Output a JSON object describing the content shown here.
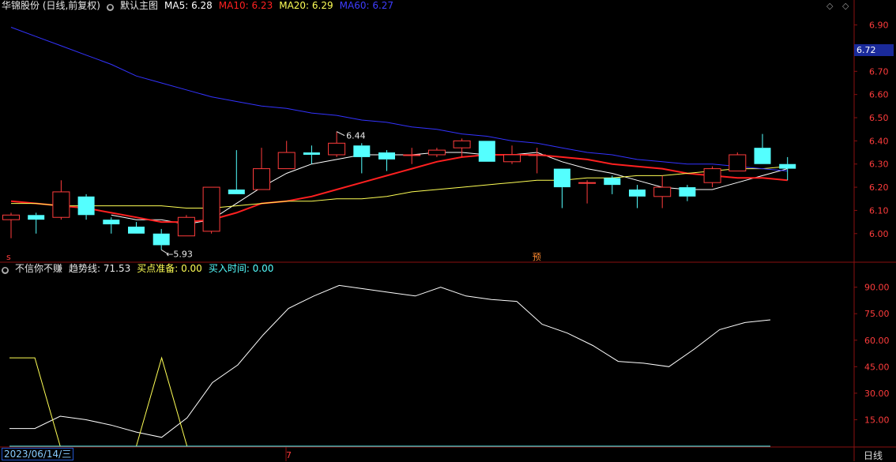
{
  "header": {
    "stock": "华锦股份 (日线,前复权)",
    "main_chart_label": "默认主图",
    "ma5": "MA5: 6.28",
    "ma10": "MA10: 6.23",
    "ma20": "MA20: 6.29",
    "ma60": "MA60: 6.27",
    "colors": {
      "ma5": "#ffffff",
      "ma10": "#ff2020",
      "ma20": "#ffff55",
      "ma60": "#3333ff"
    }
  },
  "indicator_header": {
    "name": "不信你不赚",
    "trend": "趋势线: 71.53",
    "buy_prep": "买点准备: 0.00",
    "buy_time": "买入时间: 0.00"
  },
  "current_price_tag": "6.72",
  "bottom": {
    "date": "2023/06/14/三",
    "period": "日线",
    "month_marker": "7"
  },
  "chart_data": [
    {
      "type": "candlestick",
      "ylim": [
        5.88,
        6.96
      ],
      "yticks": [
        "6.90",
        "6.80",
        "6.70",
        "6.60",
        "6.50",
        "6.40",
        "6.30",
        "6.20",
        "6.10",
        "6.00"
      ],
      "annotations": [
        {
          "text": "6.44",
          "label": "high",
          "candle_index": 13
        },
        {
          "text": "5.93",
          "label": "low",
          "candle_index": 6
        }
      ],
      "marker_labels": [
        {
          "text": "s",
          "candle_index": 0
        },
        {
          "text": "预",
          "candle_index": 21
        }
      ],
      "candles": [
        {
          "o": 6.06,
          "h": 6.09,
          "l": 5.98,
          "c": 6.08
        },
        {
          "o": 6.08,
          "h": 6.09,
          "l": 6.0,
          "c": 6.06
        },
        {
          "o": 6.07,
          "h": 6.23,
          "l": 6.06,
          "c": 6.18
        },
        {
          "o": 6.16,
          "h": 6.17,
          "l": 6.06,
          "c": 6.08
        },
        {
          "o": 6.06,
          "h": 6.07,
          "l": 6.0,
          "c": 6.04
        },
        {
          "o": 6.03,
          "h": 6.05,
          "l": 6.0,
          "c": 6.0
        },
        {
          "o": 6.0,
          "h": 6.02,
          "l": 5.93,
          "c": 5.95
        },
        {
          "o": 5.99,
          "h": 6.08,
          "l": 5.99,
          "c": 6.07
        },
        {
          "o": 6.01,
          "h": 6.2,
          "l": 6.0,
          "c": 6.2
        },
        {
          "o": 6.19,
          "h": 6.36,
          "l": 6.17,
          "c": 6.17
        },
        {
          "o": 6.19,
          "h": 6.37,
          "l": 6.19,
          "c": 6.28
        },
        {
          "o": 6.28,
          "h": 6.4,
          "l": 6.28,
          "c": 6.35
        },
        {
          "o": 6.35,
          "h": 6.38,
          "l": 6.3,
          "c": 6.34
        },
        {
          "o": 6.34,
          "h": 6.44,
          "l": 6.33,
          "c": 6.39
        },
        {
          "o": 6.38,
          "h": 6.39,
          "l": 6.26,
          "c": 6.33
        },
        {
          "o": 6.35,
          "h": 6.36,
          "l": 6.27,
          "c": 6.32
        },
        {
          "o": 6.34,
          "h": 6.37,
          "l": 6.3,
          "c": 6.34
        },
        {
          "o": 6.34,
          "h": 6.37,
          "l": 6.33,
          "c": 6.36
        },
        {
          "o": 6.37,
          "h": 6.41,
          "l": 6.33,
          "c": 6.4
        },
        {
          "o": 6.4,
          "h": 6.4,
          "l": 6.31,
          "c": 6.31
        },
        {
          "o": 6.31,
          "h": 6.38,
          "l": 6.3,
          "c": 6.34
        },
        {
          "o": 6.34,
          "h": 6.37,
          "l": 6.26,
          "c": 6.34
        },
        {
          "o": 6.28,
          "h": 6.28,
          "l": 6.11,
          "c": 6.2
        },
        {
          "o": 6.22,
          "h": 6.23,
          "l": 6.13,
          "c": 6.22
        },
        {
          "o": 6.24,
          "h": 6.25,
          "l": 6.17,
          "c": 6.21
        },
        {
          "o": 6.19,
          "h": 6.21,
          "l": 6.11,
          "c": 6.16
        },
        {
          "o": 6.16,
          "h": 6.25,
          "l": 6.11,
          "c": 6.2
        },
        {
          "o": 6.2,
          "h": 6.21,
          "l": 6.14,
          "c": 6.16
        },
        {
          "o": 6.22,
          "h": 6.29,
          "l": 6.2,
          "c": 6.28
        },
        {
          "o": 6.27,
          "h": 6.35,
          "l": 6.27,
          "c": 6.34
        },
        {
          "o": 6.37,
          "h": 6.43,
          "l": 6.3,
          "c": 6.3
        },
        {
          "o": 6.3,
          "h": 6.33,
          "l": 6.23,
          "c": 6.28
        }
      ],
      "series": [
        {
          "name": "MA5",
          "color": "#ffffff",
          "values": [
            null,
            null,
            null,
            null,
            6.08,
            6.06,
            6.06,
            6.04,
            6.06,
            6.13,
            6.2,
            6.26,
            6.3,
            6.32,
            6.34,
            6.34,
            6.34,
            6.35,
            6.35,
            6.34,
            6.34,
            6.35,
            6.31,
            6.28,
            6.26,
            6.23,
            6.2,
            6.19,
            6.19,
            6.22,
            6.25,
            6.28
          ]
        },
        {
          "name": "MA10",
          "color": "#ff2020",
          "values": [
            6.14,
            6.13,
            6.12,
            6.11,
            6.09,
            6.07,
            6.05,
            6.05,
            6.06,
            6.09,
            6.13,
            6.14,
            6.16,
            6.19,
            6.22,
            6.25,
            6.28,
            6.31,
            6.33,
            6.34,
            6.34,
            6.34,
            6.33,
            6.32,
            6.3,
            6.29,
            6.28,
            6.26,
            6.25,
            6.24,
            6.24,
            6.23
          ]
        },
        {
          "name": "MA20",
          "color": "#ffff55",
          "values": [
            6.13,
            6.13,
            6.12,
            6.12,
            6.12,
            6.12,
            6.12,
            6.11,
            6.11,
            6.12,
            6.13,
            6.14,
            6.14,
            6.15,
            6.15,
            6.16,
            6.18,
            6.19,
            6.2,
            6.21,
            6.22,
            6.23,
            6.23,
            6.24,
            6.24,
            6.25,
            6.25,
            6.26,
            6.27,
            6.28,
            6.28,
            6.29
          ]
        },
        {
          "name": "MA60",
          "color": "#3333ff",
          "values": [
            6.89,
            6.85,
            6.81,
            6.77,
            6.73,
            6.68,
            6.65,
            6.62,
            6.59,
            6.57,
            6.55,
            6.54,
            6.52,
            6.51,
            6.49,
            6.48,
            6.46,
            6.45,
            6.43,
            6.42,
            6.4,
            6.39,
            6.37,
            6.35,
            6.34,
            6.32,
            6.31,
            6.3,
            6.3,
            6.29,
            6.28,
            6.27
          ]
        }
      ]
    },
    {
      "type": "line",
      "ylim": [
        0,
        97
      ],
      "yticks": [
        "90.00",
        "75.00",
        "60.00",
        "45.00",
        "30.00",
        "15.00"
      ],
      "series": [
        {
          "name": "趋势线",
          "color": "#ffffff",
          "values": [
            10,
            10,
            17,
            15,
            12,
            8,
            5,
            16,
            36,
            46,
            63,
            78,
            85,
            91,
            89,
            87,
            85,
            90,
            85,
            83,
            82,
            69,
            64,
            57,
            48,
            47,
            45,
            55,
            66,
            70,
            71.53
          ]
        },
        {
          "name": "买点准备",
          "color": "#ffff55",
          "values": [
            50,
            50,
            0,
            0,
            0,
            0,
            50,
            0,
            0,
            0,
            0,
            0,
            0,
            0,
            0,
            0,
            0,
            0,
            0,
            0,
            0,
            0,
            0,
            0,
            0,
            0,
            0,
            0,
            0,
            0,
            0
          ]
        },
        {
          "name": "买入时间",
          "color": "#55ffff",
          "values": [
            0,
            0,
            0,
            0,
            0,
            0,
            0,
            0,
            0,
            0,
            0,
            0,
            0,
            0,
            0,
            0,
            0,
            0,
            0,
            0,
            0,
            0,
            0,
            0,
            0,
            0,
            0,
            0,
            0,
            0,
            0
          ]
        }
      ]
    }
  ]
}
